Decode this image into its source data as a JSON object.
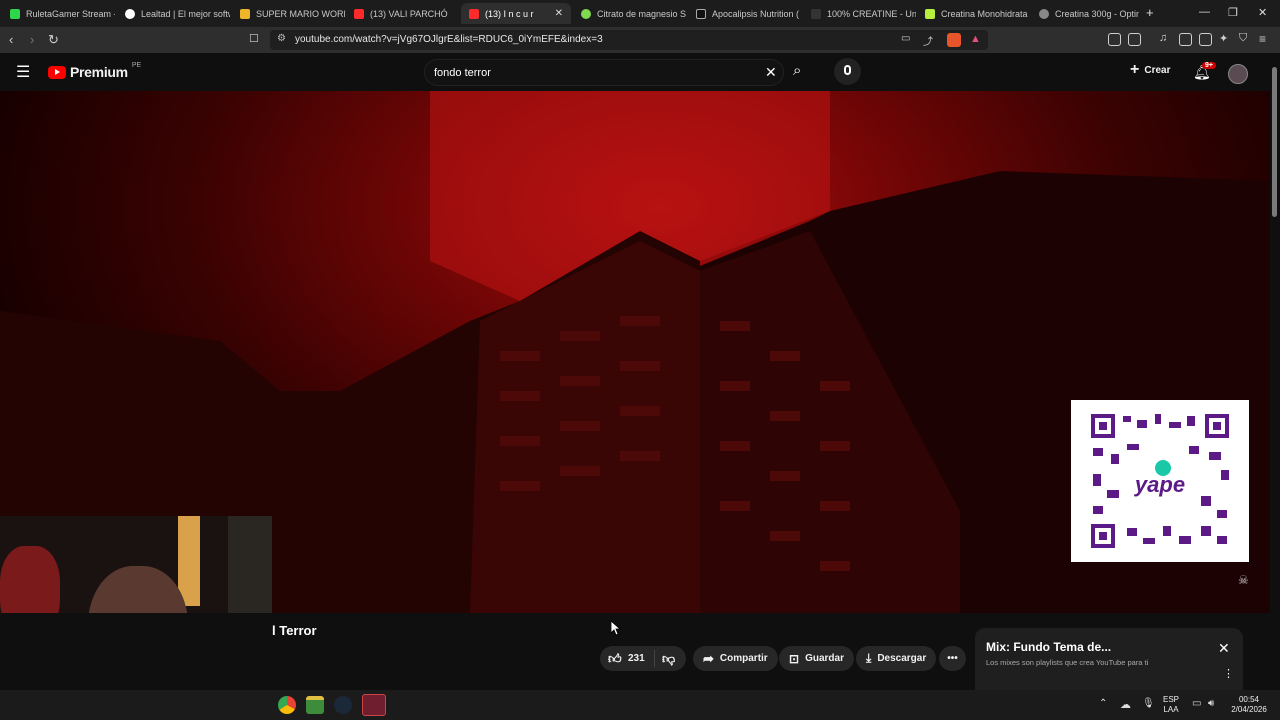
{
  "tabs": [
    {
      "label": "RuletaGamer Stream -",
      "color": "#2fd54a",
      "active": false
    },
    {
      "label": "Lealtad | El mejor softw",
      "color": "#ffffff",
      "active": false
    },
    {
      "label": "SUPER MARIO WORLD",
      "color": "#f0b429",
      "active": false
    },
    {
      "label": "(13) VALI PARCHÓ",
      "color": "#ff2a2a",
      "active": false
    },
    {
      "label": "(13) I n c u r",
      "color": "#ff2a2a",
      "active": true
    },
    {
      "label": "Citrato de magnesio S",
      "color": "#7fd84f",
      "active": false
    },
    {
      "label": "Apocalipsis Nutrition (",
      "color": "#111111",
      "active": false
    },
    {
      "label": "100% CREATINE - Univ",
      "color": "#333333",
      "active": false
    },
    {
      "label": "Creatina Monohidrata",
      "color": "#b6f03c",
      "active": false
    },
    {
      "label": "Creatina 300g - Optim",
      "color": "#888888",
      "active": false
    }
  ],
  "browser": {
    "url": "youtube.com/watch?v=jVg67OJlgrE&list=RDUC6_0iYmEFE&index=3",
    "new_tab": "+",
    "minimize": "—",
    "restore": "❐",
    "close": "✕"
  },
  "youtube": {
    "logo_text": "Premium",
    "region": "PE",
    "search_value": "fondo terror",
    "create_label": "Crear",
    "notif_count": "9+"
  },
  "video": {
    "title": "l Terror",
    "qr_label": "yape"
  },
  "actions": {
    "likes": "231",
    "share": "Compartir",
    "save": "Guardar",
    "download": "Descargar"
  },
  "mix": {
    "title": "Mix: Fundo Tema de...",
    "subtitle": "Los mixes son playlists que crea YouTube para ti"
  },
  "taskbar": {
    "lang_top": "ESP",
    "lang_bottom": "LAA",
    "time": "00:54",
    "date": "2/04/2026"
  },
  "colors": {
    "youtube_red": "#ff0000",
    "video_red": "#b01010",
    "qr_purple": "#6a1b8c",
    "notif_badge": "#cc0000"
  }
}
